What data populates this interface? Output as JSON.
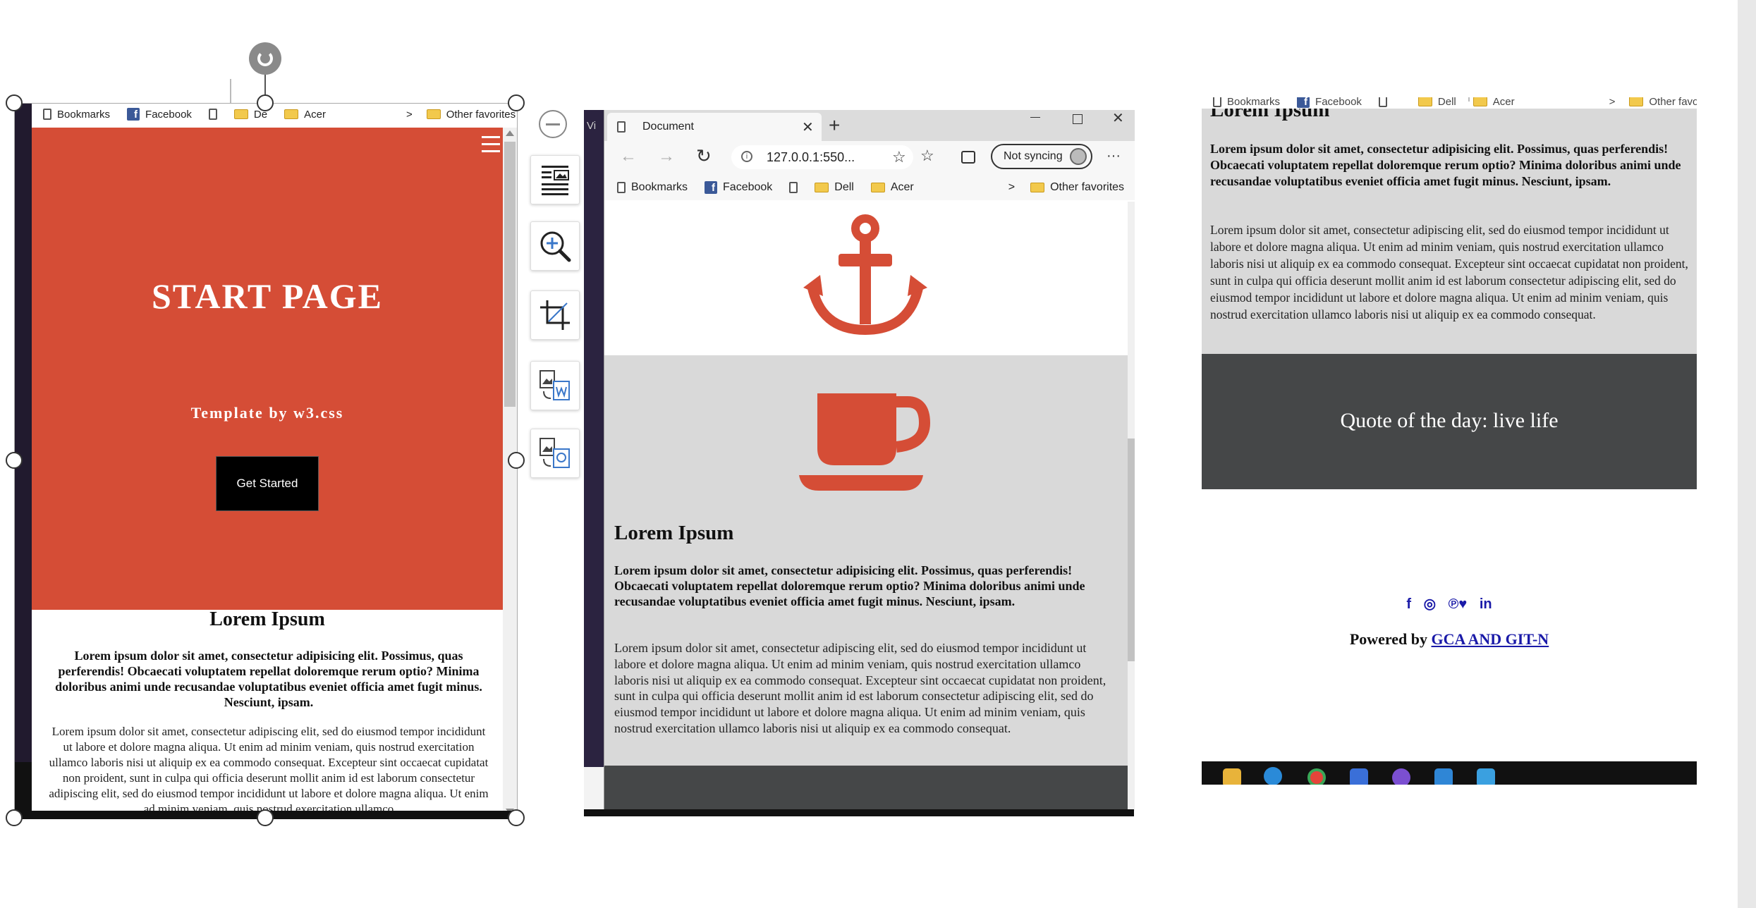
{
  "left_panel": {
    "favorites": {
      "items": [
        "Bookmarks",
        "Facebook",
        "",
        "De",
        "Acer"
      ],
      "chevron": ">",
      "other": "Other favorites"
    },
    "hero": {
      "title": "START PAGE",
      "subtitle": "Template by w3.css",
      "button": "Get Started",
      "menu_icon": "hamburger-icon",
      "bg_color": "#d54d36"
    },
    "section": {
      "heading": "Lorem Ipsum",
      "bold_text": "Lorem ipsum dolor sit amet, consectetur adipisicing elit. Possimus, quas perferendis! Obcaecati voluptatem repellat doloremque rerum optio? Minima doloribus animi unde recusandae voluptatibus eveniet officia amet fugit minus. Nesciunt, ipsam.",
      "text": "Lorem ipsum dolor sit amet, consectetur adipiscing elit, sed do eiusmod tempor incididunt ut labore et dolore magna aliqua. Ut enim ad minim veniam, quis nostrud exercitation ullamco laboris nisi ut aliquip ex ea commodo consequat. Excepteur sint occaecat cupidatat non proident, sunt in culpa qui officia deserunt mollit anim id est laborum consectetur adipiscing elit, sed do eiusmod tempor incididunt ut labore et dolore magna aliqua. Ut enim ad minim veniam, quis nostrud exercitation ullamco"
    }
  },
  "tools": {
    "items": [
      "remove-icon",
      "text-wrap-icon",
      "zoom-icon",
      "crop-icon",
      "image-to-word-icon",
      "image-to-image-icon"
    ]
  },
  "browser": {
    "tab_title": "Document",
    "new_tab": "+",
    "url": "127.0.0.1:550...",
    "sync_label": "Not syncing",
    "more": "···",
    "favorites": {
      "items": [
        "Bookmarks",
        "Facebook",
        "",
        "Dell",
        "Acer"
      ],
      "chevron": ">",
      "other": "Other favorites"
    },
    "section": {
      "heading": "Lorem Ipsum",
      "bold_text": "Lorem ipsum dolor sit amet, consectetur adipisicing elit. Possimus, quas perferendis! Obcaecati voluptatem repellat doloremque rerum optio? Minima doloribus animi unde recusandae voluptatibus eveniet officia amet fugit minus. Nesciunt, ipsam.",
      "text": "Lorem ipsum dolor sit amet, consectetur adipiscing elit, sed do eiusmod tempor incididunt ut labore et dolore magna aliqua. Ut enim ad minim veniam, quis nostrud exercitation ullamco laboris nisi ut aliquip ex ea commodo consequat. Excepteur sint occaecat cupidatat non proident, sunt in culpa qui officia deserunt mollit anim id est laborum consectetur adipiscing elit, sed do eiusmod tempor incididunt ut labore et dolore magna aliqua. Ut enim ad minim veniam, quis nostrud exercitation ullamco laboris nisi ut aliquip ex ea commodo consequat."
    },
    "side_label": "Vi"
  },
  "right_panel": {
    "favorites": {
      "items": [
        "Bookmarks",
        "Facebook",
        "",
        "Dell",
        "Acer"
      ],
      "chevron": ">",
      "other": "Other favorites"
    },
    "heading_cut": "Lorem Ipsum",
    "bold_text": "Lorem ipsum dolor sit amet, consectetur adipisicing elit. Possimus, quas perferendis! Obcaecati voluptatem repellat doloremque rerum optio? Minima doloribus animi unde recusandae voluptatibus eveniet officia amet fugit minus. Nesciunt, ipsam.",
    "text": "Lorem ipsum dolor sit amet, consectetur adipiscing elit, sed do eiusmod tempor incididunt ut labore et dolore magna aliqua. Ut enim ad minim veniam, quis nostrud exercitation ullamco laboris nisi ut aliquip ex ea commodo consequat. Excepteur sint occaecat cupidatat non proident, sunt in culpa qui officia deserunt mollit anim id est laborum consectetur adipiscing elit, sed do eiusmod tempor incididunt ut labore et dolore magna aliqua. Ut enim ad minim veniam, quis nostrud exercitation ullamco laboris nisi ut aliquip ex ea commodo consequat.",
    "quote": "Quote of the day: live life",
    "social": [
      "f",
      "◎",
      "℗",
      "♥",
      "in"
    ],
    "powered_prefix": "Powered by ",
    "powered_link": "GCA AND GIT-N"
  },
  "colors": {
    "accent": "#d54d36",
    "dark": "#454748",
    "light_gray": "#d9d9d9"
  }
}
